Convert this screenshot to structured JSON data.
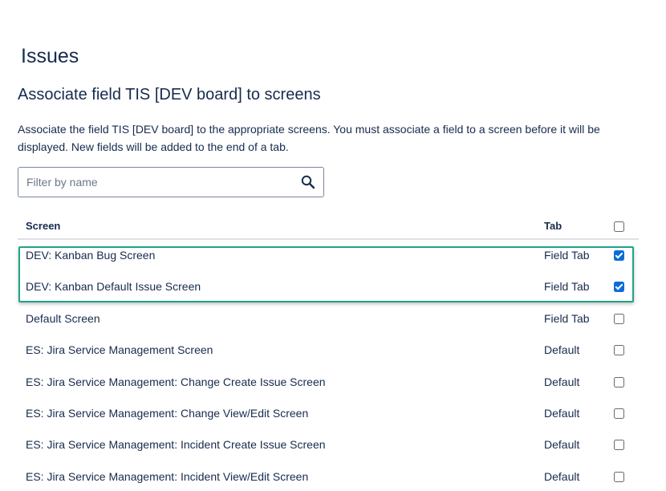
{
  "page": {
    "title": "Issues",
    "section_title": "Associate field TIS [DEV board] to screens",
    "description": "Associate the field TIS [DEV board] to the appropriate screens. You must associate a field to a screen before it will be displayed. New fields will be added to the end of a tab."
  },
  "filter": {
    "placeholder": "Filter by name",
    "value": "",
    "icon": "search-icon"
  },
  "table": {
    "headers": {
      "screen": "Screen",
      "tab": "Tab",
      "select_all_checked": false
    },
    "rows": [
      {
        "screen": "DEV: Kanban Bug Screen",
        "tab": "Field Tab",
        "checked": true
      },
      {
        "screen": "DEV: Kanban Default Issue Screen",
        "tab": "Field Tab",
        "checked": true
      },
      {
        "screen": "Default Screen",
        "tab": "Field Tab",
        "checked": false
      },
      {
        "screen": "ES: Jira Service Management Screen",
        "tab": "Default",
        "checked": false
      },
      {
        "screen": "ES: Jira Service Management: Change Create Issue Screen",
        "tab": "Default",
        "checked": false
      },
      {
        "screen": "ES: Jira Service Management: Change View/Edit Screen",
        "tab": "Default",
        "checked": false
      },
      {
        "screen": "ES: Jira Service Management: Incident Create Issue Screen",
        "tab": "Default",
        "checked": false
      },
      {
        "screen": "ES: Jira Service Management: Incident View/Edit Screen",
        "tab": "Default",
        "checked": false
      }
    ]
  },
  "colors": {
    "highlight_border": "#1fa386",
    "checkbox_checked": "#0b6bdc",
    "text": "#172b4d"
  }
}
